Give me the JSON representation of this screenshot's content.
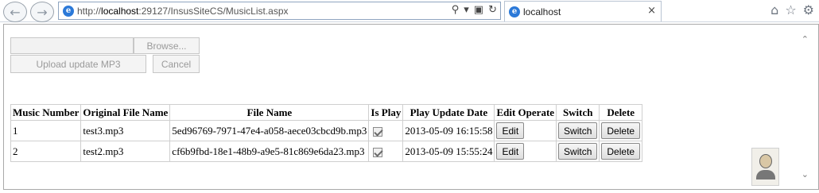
{
  "browser": {
    "back_icon": "back-arrow-icon",
    "forward_icon": "forward-arrow-icon",
    "url_prefix": "http://",
    "url_host": "localhost",
    "url_rest": ":29127/InsusSiteCS/MusicList.aspx",
    "tab_title": "localhost",
    "tab_close": "×"
  },
  "upload": {
    "browse_label": "Browse...",
    "upload_label": "Upload update MP3",
    "cancel_label": "Cancel"
  },
  "table": {
    "headers": [
      "Music Number",
      "Original File Name",
      "File Name",
      "Is Play",
      "Play Update Date",
      "Edit Operate",
      "Switch",
      "Delete"
    ],
    "rows": [
      {
        "number": "1",
        "original": "test3.mp3",
        "file": "5ed96769-7971-47e4-a058-aece03cbcd9b.mp3",
        "is_play": true,
        "date": "2013-05-09 16:15:58",
        "edit": "Edit",
        "switch": "Switch",
        "delete": "Delete"
      },
      {
        "number": "2",
        "original": "test2.mp3",
        "file": "cf6b9fbd-18e1-48b9-a9e5-81c869e6da23.mp3",
        "is_play": true,
        "date": "2013-05-09 15:55:24",
        "edit": "Edit",
        "switch": "Switch",
        "delete": "Delete"
      }
    ]
  }
}
